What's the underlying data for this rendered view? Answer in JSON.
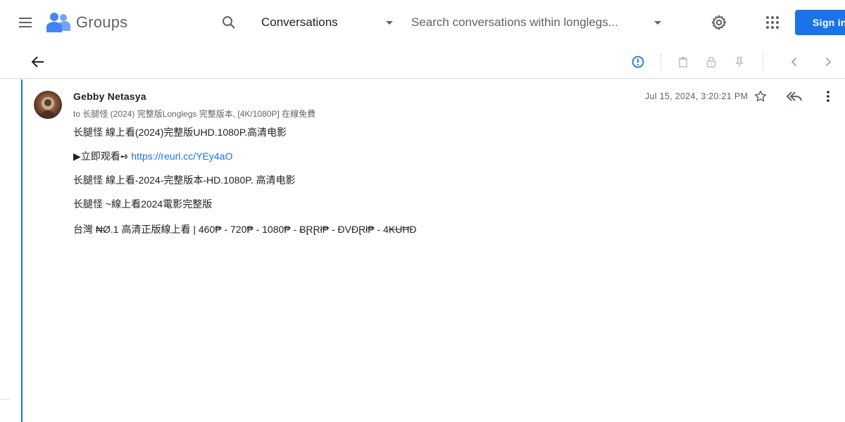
{
  "header": {
    "app_name": "Groups",
    "scope_selected": "Conversations",
    "search_placeholder": "Search conversations within longlegs...",
    "signin_label": "Sign in"
  },
  "icons": {
    "menu": "menu-icon",
    "logo": "groups-logo-icon",
    "search": "search-icon",
    "scope_caret": "caret-down-icon",
    "settings": "gear-icon",
    "apps": "apps-grid-icon",
    "back": "arrow-back-icon",
    "report": "report-icon",
    "delete": "trash-icon",
    "lock": "lock-icon",
    "pin": "pin-icon",
    "prev": "chevron-left-icon",
    "next": "chevron-right-icon",
    "star": "star-icon",
    "reply_all": "reply-all-icon",
    "more": "more-vert-icon"
  },
  "colors": {
    "accent": "#1a73e8",
    "text": "#202124",
    "secondary_text": "#5f6368",
    "divider": "#dadce0"
  },
  "message": {
    "author": "Gebby Netasya",
    "recipients": "to 长腿怪 (2024) 完整版Longlegs 完整版本, [4K/1080P] 在線免費",
    "timestamp": "Jul 15, 2024, 3:20:21 PM",
    "body": {
      "line1": "长腿怪 線上看(2024)完整版UHD.1080P.高清电影",
      "line2_prefix": "▶立即观看➺ ",
      "line2_link": "https://reurl.cc/YEy4aO",
      "line3": "长腿怪 線上看-2024-完整版本-HD.1080P. 高清电影",
      "line4": "长腿怪 ~線上看2024電影完整版",
      "line5": "台灣 ₦Ø.1 高清正版線上看 | 460₱ - 720₱ - 1080₱ - ɃⱤⱤł₱ - ĐVĐⱤł₱ - 4₭ɄĦĐ"
    }
  }
}
